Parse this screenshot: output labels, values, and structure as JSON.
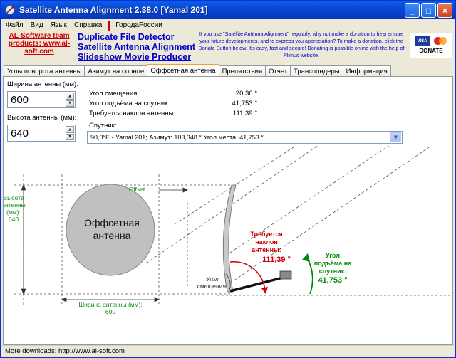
{
  "window": {
    "title": "Satellite Antenna Alignment 2.38.0 [Yamal 201]"
  },
  "window_buttons": {
    "minimize": "_",
    "maximize": "□",
    "close": "×"
  },
  "menu": {
    "items": [
      "Файл",
      "Вид",
      "Язык",
      "Справка"
    ],
    "extra": "ГородаРоссии"
  },
  "promo": {
    "left_text": "AL-Software team products: www.al-soft.com",
    "links": [
      "Duplicate File Detector",
      "Satellite Antenna Alignment",
      "Slideshow Movie Producer"
    ],
    "donate_text": "If you use \"Satellite Antenna Alignment\" regularly, why not make a donation to help ensure your future developments, and to express you appreciation? To make a donation, click the Donate Button below. It's easy, fast and secure! Donating is possible online with the help of Plimus website.",
    "donate_card_visa": "VISA",
    "donate_label": "DONATE"
  },
  "tabs": [
    {
      "label": "Углы поворота антенны",
      "active": false
    },
    {
      "label": "Азимут на солнце",
      "active": false
    },
    {
      "label": "Оффсетная антенна",
      "active": true
    },
    {
      "label": "Препятствия",
      "active": false
    },
    {
      "label": "Отчет",
      "active": false
    },
    {
      "label": "Транспондеры",
      "active": false
    },
    {
      "label": "Информация",
      "active": false
    }
  ],
  "form": {
    "width_label": "Ширина антенны (мм):",
    "width_value": "600",
    "height_label": "Высота антенны (мм):",
    "height_value": "640"
  },
  "results": {
    "offset_angle_label": "Угол смещения:",
    "offset_angle_value": "20,36 °",
    "elevation_label": "Угол подъёма на спутник:",
    "elevation_value": "41,753 °",
    "tilt_label": "Требуется наклон антенны :",
    "tilt_value": "111,39 °"
  },
  "satellite": {
    "label": "Спутник:",
    "selected": "90,0°E - Yamal 201;  Азимут: 103,348 °  Угол места: 41,753 °"
  },
  "diagram": {
    "height_label": [
      "Высота",
      "антенны",
      "(мм):",
      "640"
    ],
    "offset_label": "Offset",
    "dish_label": [
      "Оффсетная",
      "антенна"
    ],
    "width_label": [
      "Ширина антенны (мм):",
      "600"
    ],
    "tilt_label": [
      "Требуется",
      "наклон",
      "антенны:"
    ],
    "tilt_value": "111,39 °",
    "offset_angle_label": [
      "Угол",
      "смещения:"
    ],
    "elevation_label": [
      "Угол",
      "подъёма на",
      "спутник:"
    ],
    "elevation_value": "41,753 °",
    "colors": {
      "tilt": "#cc0000",
      "elevation": "#008800",
      "dish": "#c0c0c0",
      "label_green": "#0a8a0a"
    }
  },
  "status": {
    "text": "More downloads: http://www.al-soft.com"
  }
}
